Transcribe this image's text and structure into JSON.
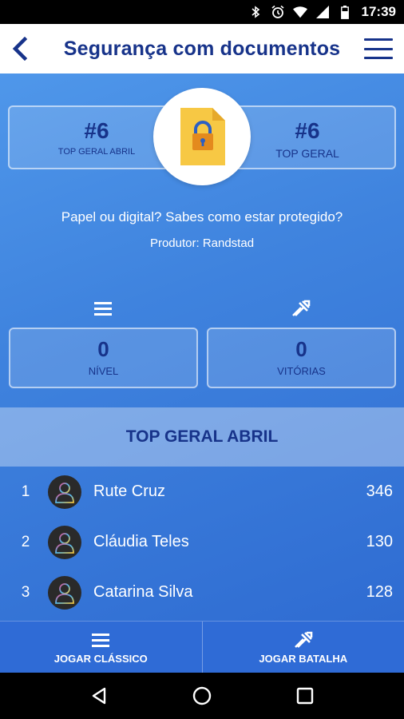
{
  "status_bar": {
    "time": "17:39",
    "icons": [
      "bluetooth-icon",
      "alarm-icon",
      "wifi-icon",
      "signal-icon",
      "battery-icon"
    ]
  },
  "app_bar": {
    "title": "Segurança com documentos",
    "back_icon": "chevron-left-icon",
    "menu_icon": "hamburger-menu-icon"
  },
  "rank": {
    "left": {
      "value": "#6",
      "label": "TOP GERAL ABRIL"
    },
    "right": {
      "value": "#6",
      "label": "TOP GERAL"
    },
    "center_icon": "document-lock-icon"
  },
  "quiz": {
    "description": "Papel ou digital? Sabes como estar protegido?",
    "producer": "Produtor: Randstad"
  },
  "stats": {
    "level": {
      "value": "0",
      "label": "NÍVEL",
      "icon": "list-lines-icon"
    },
    "wins": {
      "value": "0",
      "label": "VITÓRIAS",
      "icon": "battle-swords-icon"
    }
  },
  "leaderboard": {
    "title": "TOP GERAL ABRIL",
    "rows": [
      {
        "pos": "1",
        "name": "Rute Cruz",
        "score": "346"
      },
      {
        "pos": "2",
        "name": "Cláudia Teles",
        "score": "130"
      },
      {
        "pos": "3",
        "name": "Catarina Silva",
        "score": "128"
      }
    ]
  },
  "bottom_bar": {
    "classic": {
      "label": "JOGAR CLÁSSICO",
      "icon": "list-lines-icon"
    },
    "battle": {
      "label": "JOGAR BATALHA",
      "icon": "battle-swords-icon"
    }
  },
  "colors": {
    "brand": "#17338a",
    "background_top": "#4f97ea",
    "background_bottom": "#2f6cd2",
    "document": "#f7c844",
    "lock": "#e48a1d"
  }
}
